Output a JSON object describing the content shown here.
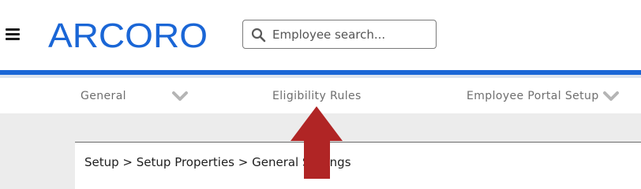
{
  "header": {
    "menu_icon": "hamburger-menu-icon",
    "logo": {
      "text": "ARCORO",
      "color": "#1a66d6"
    },
    "search": {
      "placeholder": "Employee search...",
      "value": "",
      "icon": "search-icon"
    }
  },
  "colors": {
    "accent": "#1a66d6",
    "arrow": "#b02525"
  },
  "nav": {
    "items": [
      {
        "label": "General",
        "has_dropdown": true
      },
      {
        "label": "Eligibility Rules",
        "has_dropdown": false
      },
      {
        "label": "Employee Portal Setup",
        "has_dropdown": true
      }
    ]
  },
  "content": {
    "breadcrumb": "Setup > Setup Properties > General Settings"
  },
  "annotation": {
    "icon": "up-arrow-icon"
  }
}
